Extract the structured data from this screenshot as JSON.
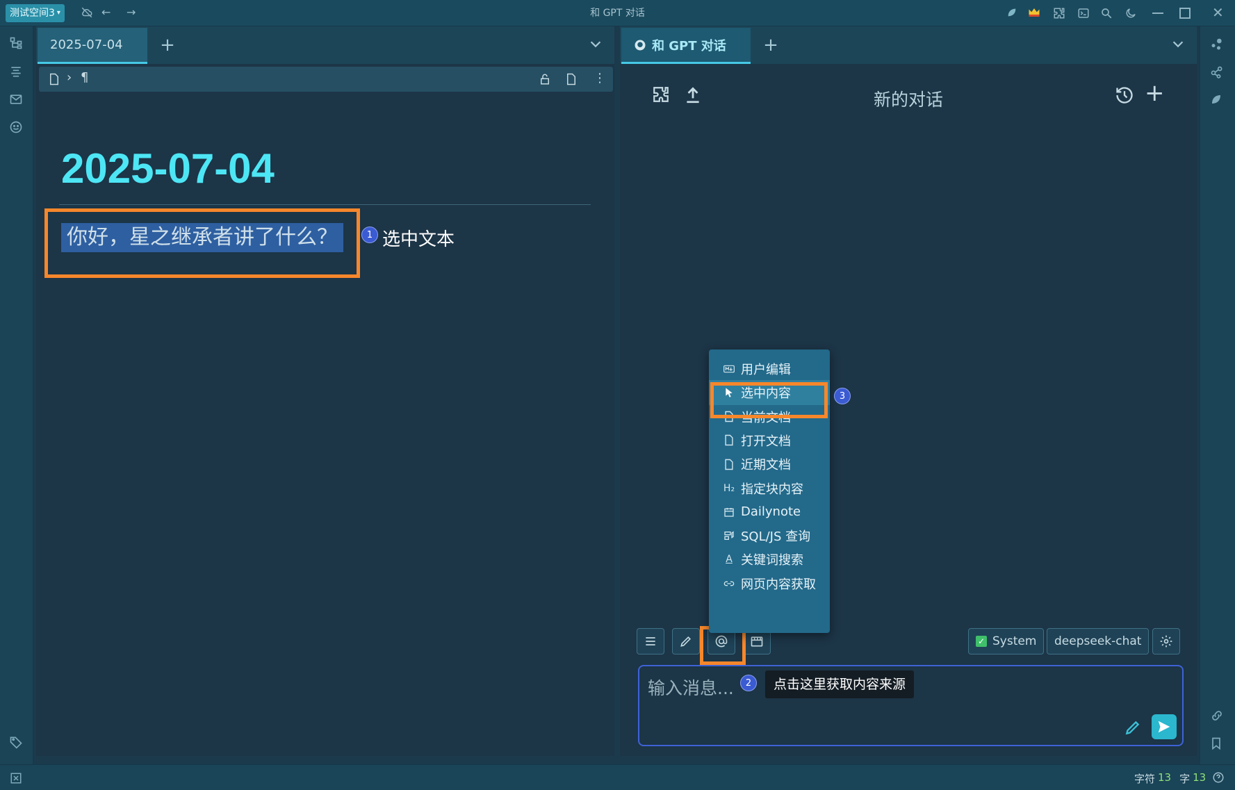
{
  "window": {
    "title": "和 GPT 对话"
  },
  "workspace": {
    "name": "测试空间3"
  },
  "left_pane": {
    "tab_label": "2025-07-04",
    "doc_title": "2025-07-04",
    "selected_text": "你好，星之继承者讲了什么？",
    "breadcrumb_sep": "›",
    "paragraph_mark": "¶"
  },
  "right_pane": {
    "tab_label": "和 GPT 对话",
    "chat_title": "新的对话",
    "input_placeholder": "输入消息...",
    "system_label": "System",
    "model_label": "deepseek-chat"
  },
  "context_menu": {
    "items": [
      {
        "label": "用户编辑",
        "icon": "markdown-icon"
      },
      {
        "label": "选中内容",
        "icon": "cursor-icon"
      },
      {
        "label": "当前文档",
        "icon": "document-icon"
      },
      {
        "label": "打开文档",
        "icon": "document-icon"
      },
      {
        "label": "近期文档",
        "icon": "document-icon"
      },
      {
        "label": "指定块内容",
        "icon": "heading-icon"
      },
      {
        "label": "Dailynote",
        "icon": "calendar-icon"
      },
      {
        "label": "SQL/JS 查询",
        "icon": "query-icon"
      },
      {
        "label": "关键词搜索",
        "icon": "keyword-icon"
      },
      {
        "label": "网页内容获取",
        "icon": "link-icon"
      }
    ]
  },
  "annotations": {
    "step1_num": "1",
    "step1_text": "选中文本",
    "step2_num": "2",
    "step2_text": "点击这里获取内容来源",
    "step3_num": "3"
  },
  "status": {
    "chars_label": "字符",
    "chars_value": "13",
    "words_label": "字",
    "words_value": "13"
  },
  "colors": {
    "accent": "#46c9e6",
    "highlight_box": "#f7872b",
    "title": "#4de6f5",
    "selection": "#2e5fa1"
  }
}
